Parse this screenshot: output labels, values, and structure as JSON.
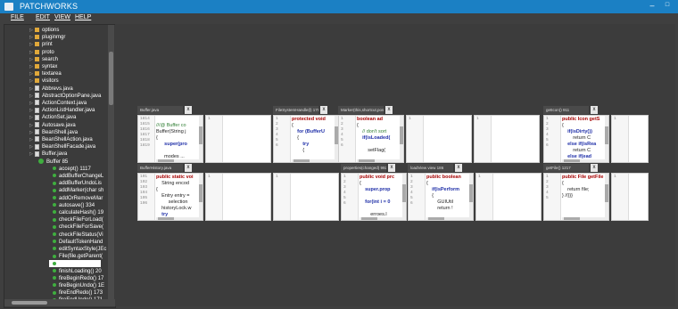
{
  "window": {
    "title": "PATCHWORKS"
  },
  "window_controls": {
    "minimize": "–",
    "maximize": "□"
  },
  "menu": {
    "file": "FILE",
    "edit": "EDIT",
    "view": "VIEW",
    "help": "HELP"
  },
  "tree": [
    {
      "label": "options",
      "type": "folder"
    },
    {
      "label": "pluginmgr",
      "type": "folder"
    },
    {
      "label": "print",
      "type": "folder"
    },
    {
      "label": "proto",
      "type": "folder"
    },
    {
      "label": "search",
      "type": "folder"
    },
    {
      "label": "syntax",
      "type": "folder"
    },
    {
      "label": "textarea",
      "type": "folder"
    },
    {
      "label": "visitors",
      "type": "folder"
    },
    {
      "label": "Abbrevs.java",
      "type": "file"
    },
    {
      "label": "AbstractOptionPane.java",
      "type": "file"
    },
    {
      "label": "ActionContext.java",
      "type": "file"
    },
    {
      "label": "ActionListHandler.java",
      "type": "file"
    },
    {
      "label": "ActionSet.java",
      "type": "file"
    },
    {
      "label": "Autosave.java",
      "type": "file"
    },
    {
      "label": "BeanShell.java",
      "type": "file"
    },
    {
      "label": "BeanShellAction.java",
      "type": "file"
    },
    {
      "label": "BeanShellFacade.java",
      "type": "file"
    },
    {
      "label": "Buffer.java",
      "type": "file"
    },
    {
      "label": "Buffer 85",
      "type": "class"
    },
    {
      "label": "accept() 1117",
      "type": "method"
    },
    {
      "label": "addBufferChangeL",
      "type": "method"
    },
    {
      "label": "addBufferUndoLis",
      "type": "method"
    },
    {
      "label": "addMarker(char sh",
      "type": "method"
    },
    {
      "label": "addOrRemoveMar",
      "type": "method"
    },
    {
      "label": "autosave() 334",
      "type": "method"
    },
    {
      "label": "calculateHash() 19",
      "type": "method"
    },
    {
      "label": "checkFileForLoad(",
      "type": "method"
    },
    {
      "label": "checkFileForSave(",
      "type": "method"
    },
    {
      "label": "checkFileStatus(Vi",
      "type": "method"
    },
    {
      "label": "DefaultTokenHand",
      "type": "method"
    },
    {
      "label": "editSyntaxStyle(JEc",
      "type": "method"
    },
    {
      "label": "File(file.getParent(",
      "type": "method"
    },
    {
      "label": "",
      "type": "method-selected"
    },
    {
      "label": "finishLoading() 20",
      "type": "method"
    },
    {
      "label": "fireBeginRedo() 17",
      "type": "method"
    },
    {
      "label": "fireBeginUndo() 1E",
      "type": "method"
    },
    {
      "label": "fireEndRedo() 173",
      "type": "method"
    },
    {
      "label": "fireEndUndo() 171",
      "type": "method"
    }
  ],
  "patches": [
    {
      "tab": "Buffer.java",
      "lines": [
        "1814",
        "1815",
        "1816",
        "1817",
        "1818",
        "1819"
      ],
      "code": [
        {
          "t": "",
          "c": ""
        },
        {
          "t": "///@ Buffer co",
          "c": "g"
        },
        {
          "t": "Buffer(String j",
          "c": ""
        },
        {
          "t": "{",
          "c": ""
        },
        {
          "t": "      super(pro",
          "c": "b"
        },
        {
          "t": "",
          "c": ""
        },
        {
          "t": "      modes ...",
          "c": ""
        }
      ]
    },
    {
      "tab": "",
      "lines": [
        "1"
      ],
      "code": []
    },
    {
      "tab": "FileSystemHandle(l) 1703",
      "lines": [
        "1",
        "2",
        "3",
        "4",
        "5",
        "6"
      ],
      "code": [
        {
          "t": "protected void",
          "c": "k"
        },
        {
          "t": "{",
          "c": ""
        },
        {
          "t": "    for (BufferU",
          "c": "b"
        },
        {
          "t": "    {",
          "c": ""
        },
        {
          "t": "        try",
          "c": "b"
        },
        {
          "t": "        {",
          "c": ""
        }
      ]
    },
    {
      "tab": "Marker(this,shortcut,pos) 1998",
      "lines": [
        "1",
        "2",
        "3",
        "4",
        "5",
        "6"
      ],
      "code": [
        {
          "t": "boolean ad",
          "c": "k"
        },
        {
          "t": "{",
          "c": ""
        },
        {
          "t": "    // don't sort",
          "c": "g"
        },
        {
          "t": "    if(isLoaded(",
          "c": "b"
        },
        {
          "t": "",
          "c": ""
        },
        {
          "t": "        setFlag(",
          "c": ""
        }
      ]
    },
    {
      "tab": "",
      "lines": [
        "1"
      ],
      "code": []
    },
    {
      "tab": "",
      "lines": [
        "1"
      ],
      "code": []
    },
    {
      "tab": "getIcon() 911",
      "lines": [
        "1",
        "2",
        "3",
        "4",
        "5",
        "6"
      ],
      "code": [
        {
          "t": "public Icon getS",
          "c": "k"
        },
        {
          "t": "{",
          "c": ""
        },
        {
          "t": "    if(isDirty())",
          "c": "b"
        },
        {
          "t": "        return C",
          "c": ""
        },
        {
          "t": "    else if(isRea",
          "c": "b"
        },
        {
          "t": "        return C",
          "c": ""
        },
        {
          "t": "    else if(ead",
          "c": "b"
        }
      ]
    },
    {
      "tab": "",
      "lines": [
        "1"
      ],
      "code": []
    },
    {
      "tab": "BufferHistory.java",
      "lines": [
        "101",
        "102",
        "103",
        "104",
        "105",
        "106"
      ],
      "code": [
        {
          "t": "public static voi",
          "c": "k"
        },
        {
          "t": "    String encod",
          "c": ""
        },
        {
          "t": "{",
          "c": ""
        },
        {
          "t": "    Entry entry =",
          "c": ""
        },
        {
          "t": "         selection",
          "c": ""
        },
        {
          "t": "    historyLock.w",
          "c": ""
        },
        {
          "t": "    try",
          "c": "b"
        }
      ]
    },
    {
      "tab": "",
      "lines": [
        "1"
      ],
      "code": []
    },
    {
      "tab": "",
      "lines": [
        "1"
      ],
      "code": []
    },
    {
      "tab": "properties(changed) 992",
      "lines": [
        "1",
        "2",
        "3",
        "4",
        "5",
        "6"
      ],
      "code": [
        {
          "t": "public void prc",
          "c": "k"
        },
        {
          "t": "{",
          "c": ""
        },
        {
          "t": "    super.prop",
          "c": "b"
        },
        {
          "t": "",
          "c": ""
        },
        {
          "t": "    for(int i = 0",
          "c": "b"
        },
        {
          "t": "",
          "c": ""
        },
        {
          "t": "        erroes.l",
          "c": ""
        }
      ]
    },
    {
      "tab": "loadView view 186",
      "lines": [
        "1",
        "2",
        "3",
        "4",
        "5",
        "6"
      ],
      "code": [
        {
          "t": "public boolean",
          "c": "k"
        },
        {
          "t": "{",
          "c": ""
        },
        {
          "t": "    if(isPerform",
          "c": "b"
        },
        {
          "t": "    {",
          "c": ""
        },
        {
          "t": "        GUIUtil",
          "c": ""
        },
        {
          "t": "        return !",
          "c": ""
        }
      ]
    },
    {
      "tab": "",
      "lines": [
        "1"
      ],
      "code": []
    },
    {
      "tab": "getFile() 1217",
      "lines": [
        "1",
        "2",
        "3",
        "4",
        "5"
      ],
      "code": [
        {
          "t": "public File getFile",
          "c": "k"
        },
        {
          "t": "{",
          "c": ""
        },
        {
          "t": "    return file;",
          "c": ""
        },
        {
          "t": "} //}}}",
          "c": ""
        },
        {
          "t": "",
          "c": ""
        }
      ]
    },
    {
      "tab": "",
      "lines": [
        "1"
      ],
      "code": []
    }
  ]
}
